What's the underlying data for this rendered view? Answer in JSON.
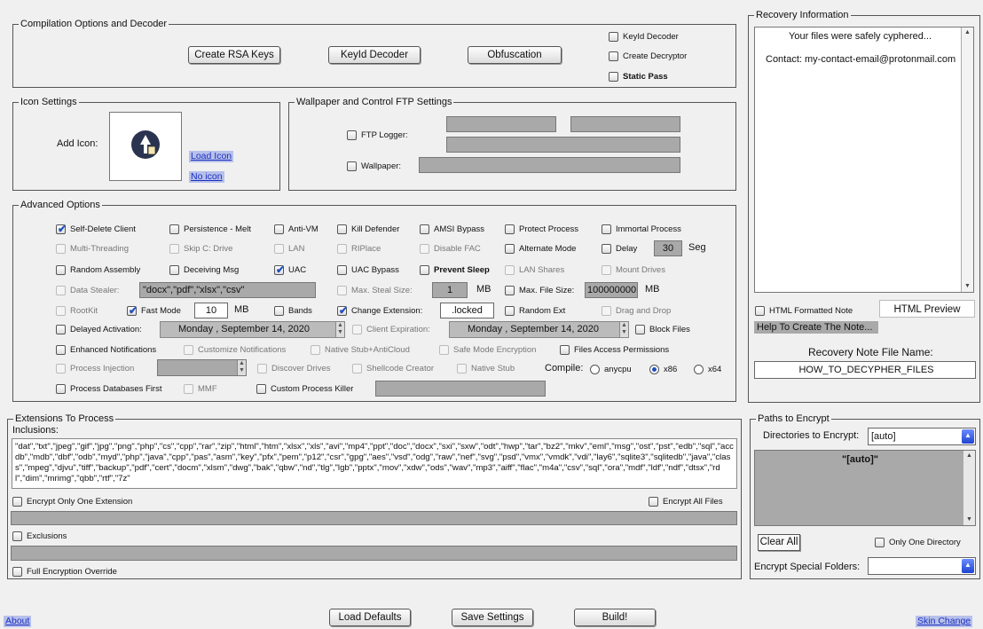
{
  "compilation": {
    "title": "Compilation Options and Decoder",
    "buttons": [
      "Create RSA Keys",
      "KeyId Decoder",
      "Obfuscation"
    ],
    "checks": [
      {
        "label": "KeyId Decoder",
        "checked": false,
        "bold": false
      },
      {
        "label": "Create Decryptor",
        "checked": false,
        "bold": false
      },
      {
        "label": "Static Pass",
        "checked": false,
        "bold": true
      }
    ]
  },
  "icon_settings": {
    "title": "Icon Settings",
    "add_icon_label": "Add Icon:",
    "load_icon": "Load Icon",
    "no_icon": "No icon",
    "icon": "app-icon"
  },
  "wallpaper": {
    "title": "Wallpaper and Control FTP Settings",
    "ftp_logger": "FTP Logger:",
    "wallpaper_label": "Wallpaper:"
  },
  "advanced": {
    "title": "Advanced Options",
    "options": [
      {
        "label": "Self-Delete Client",
        "checked": true,
        "dim": false,
        "bold": false
      },
      {
        "label": "Persistence - Melt",
        "checked": false,
        "dim": false,
        "bold": false
      },
      {
        "label": "Anti-VM",
        "checked": false,
        "dim": false,
        "bold": false
      },
      {
        "label": "Kill Defender",
        "checked": false,
        "dim": false,
        "bold": false
      },
      {
        "label": "AMSI Bypass",
        "checked": false,
        "dim": false,
        "bold": false
      },
      {
        "label": "Protect Process",
        "checked": false,
        "dim": false,
        "bold": false
      },
      {
        "label": "Immortal Process",
        "checked": false,
        "dim": false,
        "bold": false
      },
      {
        "label": "Multi-Threading",
        "checked": false,
        "dim": true,
        "bold": false
      },
      {
        "label": "Skip C: Drive",
        "checked": false,
        "dim": true,
        "bold": false
      },
      {
        "label": "LAN",
        "checked": false,
        "dim": true,
        "bold": false
      },
      {
        "label": "RIPlace",
        "checked": false,
        "dim": true,
        "bold": false
      },
      {
        "label": "Disable FAC",
        "checked": false,
        "dim": true,
        "bold": false
      },
      {
        "label": "Alternate Mode",
        "checked": false,
        "dim": false,
        "bold": false
      },
      {
        "label": "Delay",
        "checked": false,
        "dim": false,
        "bold": false
      },
      {
        "label": "Random Assembly",
        "checked": false,
        "dim": false,
        "bold": false
      },
      {
        "label": "Deceiving Msg",
        "checked": false,
        "dim": false,
        "bold": false
      },
      {
        "label": "UAC",
        "checked": true,
        "dim": false,
        "bold": false
      },
      {
        "label": "UAC Bypass",
        "checked": false,
        "dim": false,
        "bold": false
      },
      {
        "label": "Prevent Sleep",
        "checked": false,
        "dim": false,
        "bold": true
      },
      {
        "label": "LAN Shares",
        "checked": false,
        "dim": true,
        "bold": false
      },
      {
        "label": "Mount Drives",
        "checked": false,
        "dim": true,
        "bold": false
      },
      {
        "label": "Data Stealer:",
        "checked": false,
        "dim": true,
        "bold": false
      },
      {
        "label": "Max. Steal Size:",
        "checked": false,
        "dim": true,
        "bold": false
      },
      {
        "label": "Max. File Size:",
        "checked": false,
        "dim": false,
        "bold": false
      },
      {
        "label": "RootKit",
        "checked": false,
        "dim": true,
        "bold": false
      },
      {
        "label": "Fast Mode",
        "checked": true,
        "dim": false,
        "bold": false
      },
      {
        "label": "Bands",
        "checked": false,
        "dim": false,
        "bold": false
      },
      {
        "label": "Change Extension:",
        "checked": true,
        "dim": false,
        "bold": false
      },
      {
        "label": "Random Ext",
        "checked": false,
        "dim": false,
        "bold": false
      },
      {
        "label": "Drag and Drop",
        "checked": false,
        "dim": true,
        "bold": false
      },
      {
        "label": "Delayed Activation:",
        "checked": false,
        "dim": false,
        "bold": false
      },
      {
        "label": "Client Expiration:",
        "checked": false,
        "dim": true,
        "bold": false
      },
      {
        "label": "Block Files",
        "checked": false,
        "dim": false,
        "bold": false
      },
      {
        "label": "Enhanced Notifications",
        "checked": false,
        "dim": false,
        "bold": false
      },
      {
        "label": "Customize Notifications",
        "checked": false,
        "dim": true,
        "bold": false
      },
      {
        "label": "Native Stub+AntiCloud",
        "checked": false,
        "dim": true,
        "bold": false
      },
      {
        "label": "Safe Mode Encryption",
        "checked": false,
        "dim": true,
        "bold": false
      },
      {
        "label": "Files Access Permissions",
        "checked": false,
        "dim": false,
        "bold": false
      },
      {
        "label": "Process Injection",
        "checked": false,
        "dim": true,
        "bold": false
      },
      {
        "label": "Discover Drives",
        "checked": false,
        "dim": true,
        "bold": false
      },
      {
        "label": "Shellcode Creator",
        "checked": false,
        "dim": true,
        "bold": false
      },
      {
        "label": "Native Stub",
        "checked": false,
        "dim": true,
        "bold": false
      },
      {
        "label": "Process Databases First",
        "checked": false,
        "dim": false,
        "bold": false
      },
      {
        "label": "MMF",
        "checked": false,
        "dim": true,
        "bold": false
      },
      {
        "label": "Custom Process Killer",
        "checked": false,
        "dim": false,
        "bold": false
      }
    ],
    "delay_value": "30",
    "delay_unit": "Seg",
    "data_stealer_value": "\"docx\",\"pdf\",\"xlsx\",\"csv\"",
    "max_steal_value": "1",
    "max_steal_unit": "MB",
    "max_file_value": "100000000",
    "max_file_unit": "MB",
    "fast_mode_value": "10",
    "fast_mode_unit": "MB",
    "extension_value": ".locked",
    "delayed_date": "Monday   , September 14, 2020",
    "expiration_date": "Monday   , September 14, 2020",
    "compile_label": "Compile:",
    "compile_options": [
      {
        "label": "anycpu",
        "selected": false
      },
      {
        "label": "x86",
        "selected": true
      },
      {
        "label": "x64",
        "selected": false
      }
    ]
  },
  "recovery": {
    "title": "Recovery Information",
    "note_line1": "Your files were safely cyphered...",
    "note_line2": "Contact: my-contact-email@protonmail.com",
    "html_formatted": "HTML Formatted Note",
    "html_preview": "HTML Preview",
    "help_link": "Help To Create The Note...",
    "file_name_label": "Recovery Note File Name:",
    "file_name_value": "HOW_TO_DECYPHER_FILES"
  },
  "extensions": {
    "title": "Extensions To Process",
    "inclusions_label": "Inclusions:",
    "inclusions_text": "\"dat\",\"txt\",\"jpeg\",\"gif\",\"jpg\",\"png\",\"php\",\"cs\",\"cpp\",\"rar\",\"zip\",\"html\",\"htm\",\"xlsx\",\"xls\",\"avi\",\"mp4\",\"ppt\",\"doc\",\"docx\",\"sxi\",\"sxw\",\"odt\",\"hwp\",\"tar\",\"bz2\",\"mkv\",\"eml\",\"msg\",\"ost\",\"pst\",\"edb\",\"sql\",\"accdb\",\"mdb\",\"dbf\",\"odb\",\"myd\",\"php\",\"java\",\"cpp\",\"pas\",\"asm\",\"key\",\"pfx\",\"pem\",\"p12\",\"csr\",\"gpg\",\"aes\",\"vsd\",\"odg\",\"raw\",\"nef\",\"svg\",\"psd\",\"vmx\",\"vmdk\",\"vdi\",\"lay6\",\"sqlite3\",\"sqlitedb\",\"java\",\"class\",\"mpeg\",\"djvu\",\"tiff\",\"backup\",\"pdf\",\"cert\",\"docm\",\"xlsm\",\"dwg\",\"bak\",\"qbw\",\"nd\",\"tlg\",\"lgb\",\"pptx\",\"mov\",\"xdw\",\"ods\",\"wav\",\"mp3\",\"aiff\",\"flac\",\"m4a\",\"csv\",\"sql\",\"ora\",\"mdf\",\"ldf\",\"ndf\",\"dtsx\",\"rdl\",\"dim\",\"mrimg\",\"qbb\",\"rtf\",\"7z\"",
    "encrypt_one": "Encrypt Only One Extension",
    "encrypt_all": "Encrypt All Files",
    "exclusions": "Exclusions",
    "full_override": "Full Encryption Override"
  },
  "paths": {
    "title": "Paths to Encrypt",
    "dirs_label": "Directories to Encrypt:",
    "dirs_value": "[auto]",
    "list_item": "\"[auto]\"",
    "clear_all": "Clear All",
    "only_one_dir": "Only One Directory",
    "special_folders_label": "Encrypt Special Folders:"
  },
  "footer": {
    "about": "About",
    "load_defaults": "Load Defaults",
    "save_settings": "Save Settings",
    "build": "Build!",
    "skin_change": "Skin Change"
  }
}
